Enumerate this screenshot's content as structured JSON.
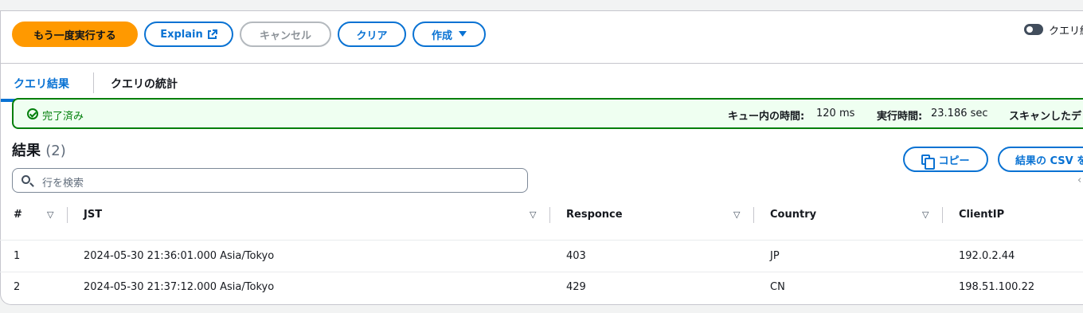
{
  "toolbar": {
    "rerun_label": "もう一度実行する",
    "explain_label": "Explain",
    "cancel_label": "キャンセル",
    "clear_label": "クリア",
    "create_label": "作成",
    "toggle_label": "クエリ結"
  },
  "tabs": {
    "results": "クエリ結果",
    "stats": "クエリの統計"
  },
  "status": {
    "text": "完了済み",
    "queue_label": "キュー内の時間:",
    "queue_value": "120 ms",
    "exec_label": "実行時間:",
    "exec_value": "23.186 sec",
    "scan_label": "スキャンしたデ"
  },
  "results": {
    "title": "結果",
    "count": "(2)",
    "copy_label": "コピー",
    "csv_label": "結果の CSV を",
    "search_placeholder": "行を検索"
  },
  "table": {
    "headers": [
      "#",
      "JST",
      "Responce",
      "Country",
      "ClientIP"
    ],
    "rows": [
      [
        "1",
        "2024-05-30 21:36:01.000 Asia/Tokyo",
        "403",
        "JP",
        "192.0.2.44"
      ],
      [
        "2",
        "2024-05-30 21:37:12.000 Asia/Tokyo",
        "429",
        "CN",
        "198.51.100.22"
      ]
    ]
  },
  "colors": {
    "accent": "#0972d3",
    "primary": "#ff9900",
    "success": "#037f0c"
  }
}
